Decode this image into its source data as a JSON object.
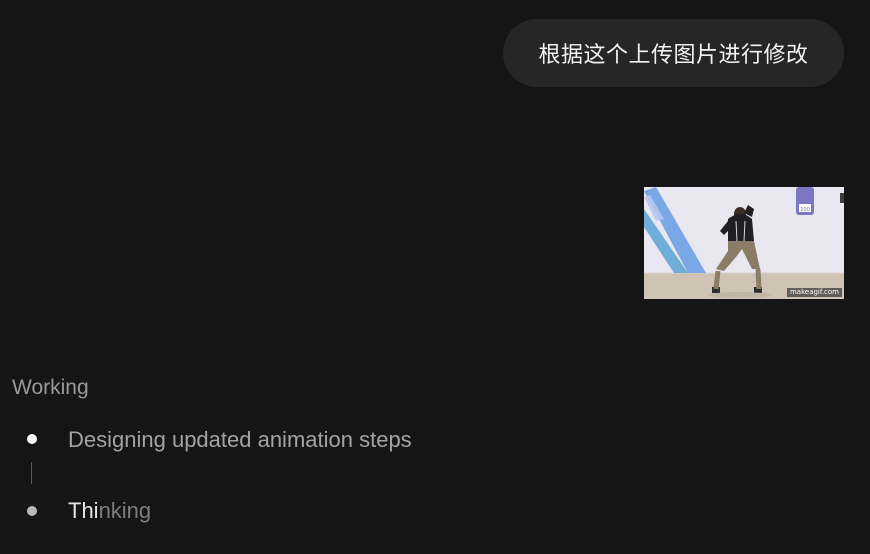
{
  "user_message": {
    "text": "根据这个上传图片进行修改"
  },
  "attachment": {
    "kind": "gif-thumbnail",
    "watermark": "makeagif.com",
    "sign_text": "100"
  },
  "progress": {
    "status": "Working",
    "steps": [
      {
        "label": "Designing updated animation steps",
        "state": "done"
      },
      {
        "label_bright": "Thi",
        "label_dim": "nking",
        "state": "active"
      }
    ]
  },
  "colors": {
    "background": "#151515",
    "bubble": "#262626",
    "text_primary": "#f2f2f2",
    "text_muted": "#9a9a9a",
    "bullet_done": "#ffffff",
    "bullet_active": "#b8b8b8"
  }
}
